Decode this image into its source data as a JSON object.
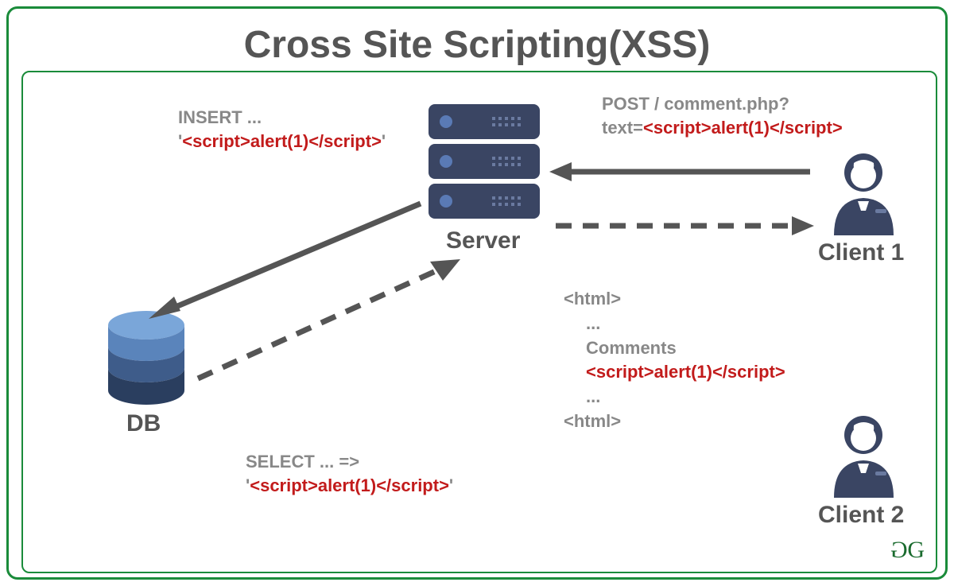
{
  "title": "Cross Site Scripting(XSS)",
  "nodes": {
    "server": "Server",
    "db": "DB",
    "client1": "Client 1",
    "client2": "Client 2"
  },
  "labels": {
    "insert_prefix": "INSERT ...",
    "insert_quote_open": "'",
    "insert_payload": "<script>alert(1)</script>",
    "insert_quote_close": "'",
    "select_prefix": "SELECT ... =>",
    "select_quote_open": "'",
    "select_payload": "<script>alert(1)</script>",
    "select_quote_close": "'",
    "post_line1": "POST / comment.php?",
    "post_line2_prefix": "text=",
    "post_payload": "<script>alert(1)</script>",
    "html_open": "<html>",
    "html_dots1": "...",
    "html_comments": "Comments",
    "html_payload": "<script>alert(1)</script>",
    "html_dots2": "...",
    "html_close": "<html>"
  },
  "watermark": "GG",
  "colors": {
    "frame": "#1a8b3a",
    "text_gray": "#888",
    "text_dark": "#555",
    "text_red": "#c21b1b",
    "server_dark": "#3a4563",
    "server_light": "#4a5a82",
    "db_top": "#7aa6d9",
    "db_mid": "#3e5c8a",
    "db_bottom": "#2a3e5f",
    "person": "#3a4563"
  }
}
